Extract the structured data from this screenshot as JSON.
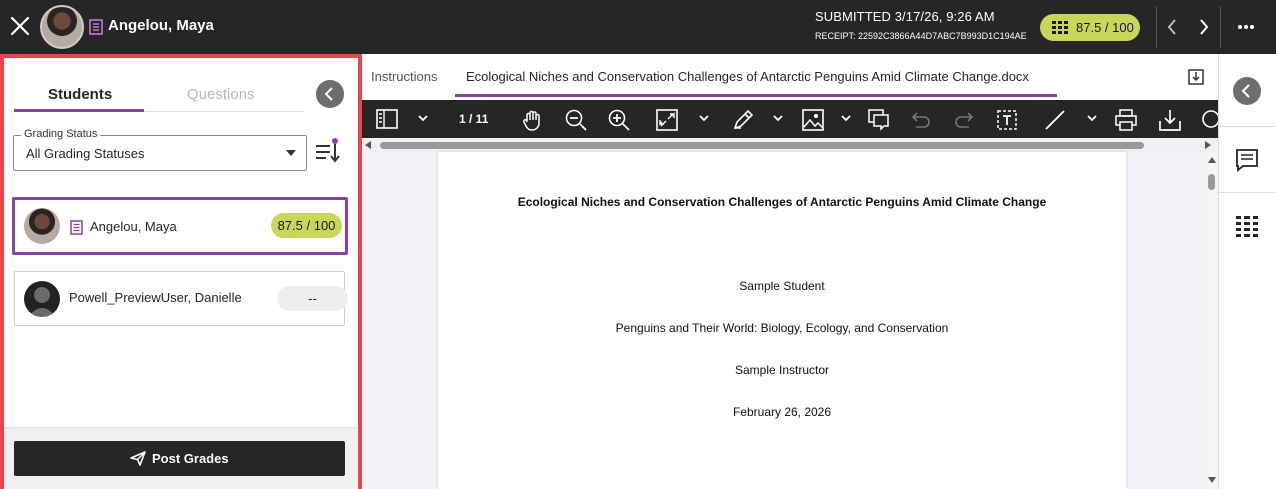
{
  "header": {
    "student_name": "Angelou, Maya",
    "submitted": "SUBMITTED 3/17/26, 9:26 AM",
    "receipt": "RECEIPT: 22592C3866A44D7ABC7B993D1C194AE",
    "score": "87.5 / 100"
  },
  "left_panel": {
    "tabs": {
      "students": "Students",
      "questions": "Questions"
    },
    "grading_status_label": "Grading Status",
    "grading_status_value": "All Grading Statuses",
    "students": [
      {
        "name": "Angelou, Maya",
        "score": "87.5 / 100"
      },
      {
        "name": "Powell_PreviewUser, Danielle",
        "score": "--"
      }
    ],
    "post_grades_label": "Post Grades"
  },
  "document": {
    "tabs": {
      "instructions": "Instructions",
      "file": "Ecological Niches and Conservation Challenges of Antarctic Penguins Amid Climate Change.docx"
    },
    "page_indicator": "1 / 11",
    "lines": {
      "title": "Ecological Niches and Conservation Challenges of Antarctic Penguins Amid Climate Change",
      "student": "Sample Student",
      "course": "Penguins and Their World: Biology, Ecology, and Conservation",
      "instructor": "Sample Instructor",
      "date": "February 26, 2026"
    }
  },
  "colors": {
    "accent_purple": "#8b3fa8",
    "score_green": "#c7d75a",
    "highlight_red": "#e8464b",
    "dark": "#262626"
  },
  "icons": [
    "close-icon",
    "submission-icon",
    "rubric-icon",
    "chevron-left-icon",
    "chevron-right-icon",
    "more-icon",
    "sort-icon",
    "send-icon",
    "download-icon",
    "sidebar-icon",
    "hand-icon",
    "zoom-out-icon",
    "zoom-in-icon",
    "fit-icon",
    "pen-icon",
    "image-icon",
    "comment-icon",
    "undo-icon",
    "redo-icon",
    "text-box-icon",
    "line-icon",
    "print-icon",
    "search-icon",
    "feedback-icon"
  ]
}
